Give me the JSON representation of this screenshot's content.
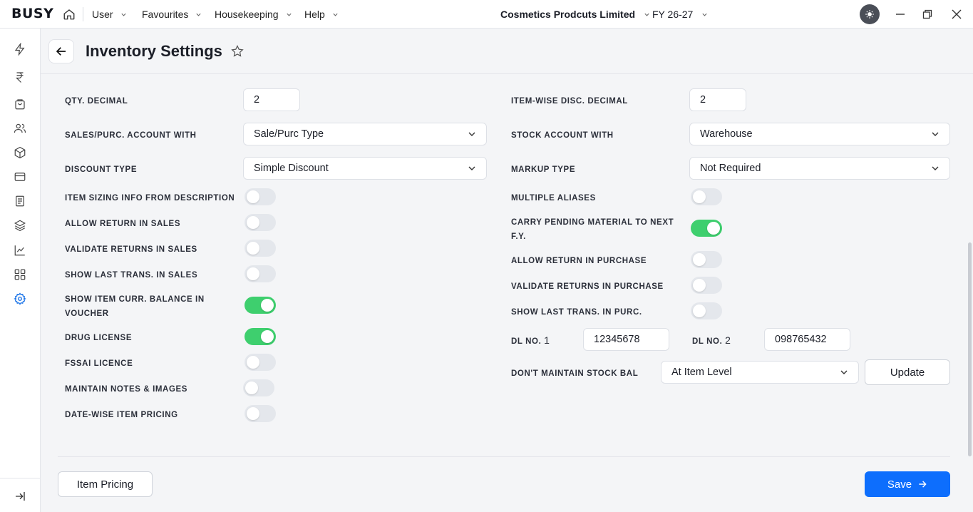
{
  "topbar": {
    "logo": "BUSY",
    "menus": [
      "User",
      "Favourites",
      "Housekeeping",
      "Help"
    ],
    "company": "Cosmetics Prodcuts Limited",
    "fy": "FY 26-27"
  },
  "header": {
    "title": "Inventory Settings"
  },
  "left": {
    "qty_decimal": {
      "label": "QTY. DECIMAL",
      "value": "2"
    },
    "sales_purc_account": {
      "label": "SALES/PURC. ACCOUNT WITH",
      "value": "Sale/Purc Type"
    },
    "discount_type": {
      "label": "DISCOUNT TYPE",
      "value": "Simple Discount"
    },
    "toggles": [
      {
        "label": "ITEM SIZING INFO FROM DESCRIPTION",
        "on": false
      },
      {
        "label": "ALLOW RETURN IN SALES",
        "on": false
      },
      {
        "label": "VALIDATE RETURNS IN SALES",
        "on": false
      },
      {
        "label": "SHOW LAST TRANS. IN SALES",
        "on": false
      },
      {
        "label_line1": "SHOW ITEM CURR. BALANCE IN",
        "label_line2": "VOUCHER",
        "on": true
      },
      {
        "label": "DRUG LICENSE",
        "on": true
      },
      {
        "label": "FSSAI LICENCE",
        "on": false
      },
      {
        "label": "MAINTAIN NOTES & IMAGES",
        "on": false
      },
      {
        "label": "DATE-WISE ITEM PRICING",
        "on": false
      }
    ]
  },
  "right": {
    "itemwise_disc_decimal": {
      "label": "ITEM-WISE DISC. DECIMAL",
      "value": "2"
    },
    "stock_account": {
      "label": "STOCK ACCOUNT WITH",
      "value": "Warehouse"
    },
    "markup_type": {
      "label": "MARKUP TYPE",
      "value": "Not Required"
    },
    "toggles": [
      {
        "label": "MULTIPLE ALIASES",
        "on": false
      },
      {
        "label_line1": "CARRY PENDING MATERIAL TO NEXT",
        "label_line2": "F.Y.",
        "on": true
      },
      {
        "label": "ALLOW RETURN IN PURCHASE",
        "on": false
      },
      {
        "label": "VALIDATE RETURNS IN PURCHASE",
        "on": false
      },
      {
        "label": "SHOW LAST TRANS. IN PURC.",
        "on": false
      }
    ],
    "dl1": {
      "label_prefix": "DL NO.",
      "label_num": "1",
      "value": "12345678"
    },
    "dl2": {
      "label_prefix": "DL NO.",
      "label_num": "2",
      "value": "098765432"
    },
    "dont_maintain": {
      "label": "DON'T MAINTAIN STOCK BAL",
      "value": "At Item Level",
      "button": "Update"
    }
  },
  "footer": {
    "item_pricing": "Item Pricing",
    "save": "Save"
  }
}
